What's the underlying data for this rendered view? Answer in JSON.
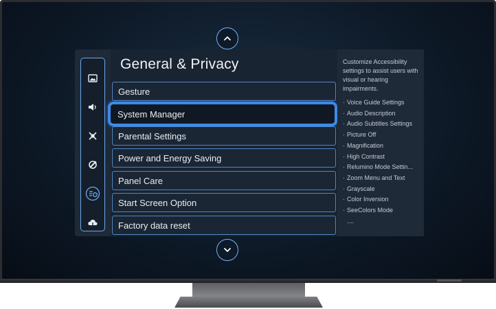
{
  "menu": {
    "title": "General & Privacy",
    "items": [
      {
        "label": "Gesture"
      },
      {
        "label": "System Manager"
      },
      {
        "label": "Parental Settings"
      },
      {
        "label": "Power and Energy Saving"
      },
      {
        "label": "Panel Care"
      },
      {
        "label": "Start Screen Option"
      },
      {
        "label": "Factory data reset"
      }
    ],
    "focused_index": 1
  },
  "sidebar": {
    "icons": [
      "picture-icon",
      "sound-icon",
      "connection-icon",
      "support-icon",
      "general-privacy-icon",
      "cloud-icon"
    ],
    "active_index": 4
  },
  "info": {
    "description": "Customize Accessibility settings to assist users with visual or hearing impairments.",
    "bullet": "·",
    "items": [
      "Voice Guide Settings",
      "Audio Description",
      "Audio Subtitles Settings",
      "Picture Off",
      "Magnification",
      "High Contrast",
      "Relumino Mode Settin...",
      "Zoom Menu and Text",
      "Grayscale",
      "Color Inversion",
      "SeeColors Mode",
      "...."
    ]
  },
  "colors": {
    "accent": "#3d8ae8",
    "item_border": "#4f87c4",
    "screen_bg": "#0e1a28"
  }
}
